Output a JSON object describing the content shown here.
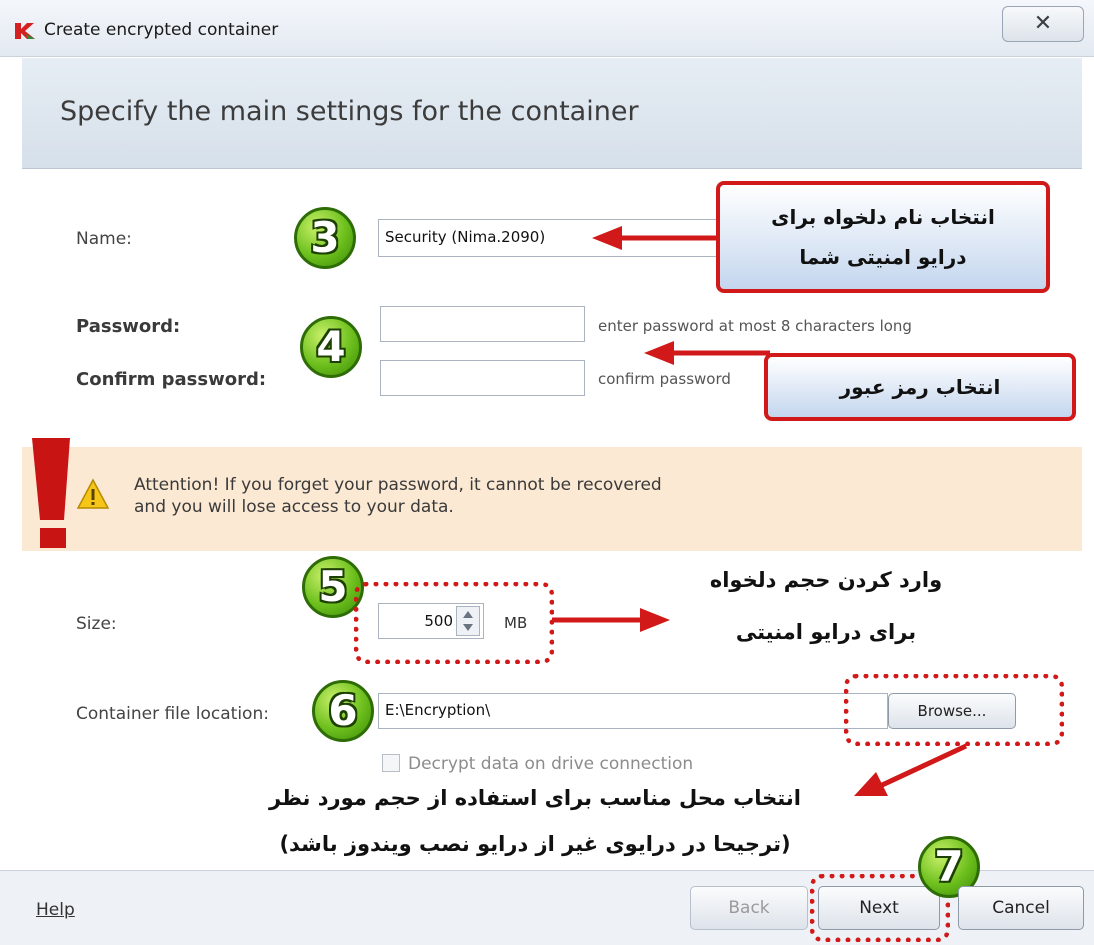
{
  "window": {
    "title": "Create encrypted container",
    "close_label": "✕"
  },
  "header": {
    "title": "Specify the main settings for the container"
  },
  "form": {
    "name_label": "Name:",
    "name_value": "Security (Nima.2090)",
    "password_label": "Password:",
    "password_hint": "enter password at most 8 characters long",
    "confirm_label": "Confirm password:",
    "confirm_hint": "confirm password",
    "size_label": "Size:",
    "size_value": "500",
    "size_unit": "MB",
    "location_label": "Container file location:",
    "location_value": "E:\\Encryption\\",
    "browse_label": "Browse...",
    "decrypt_label": "Decrypt data on drive connection"
  },
  "attention": {
    "line1": "Attention! If you forget your password, it cannot be recovered",
    "line2": "and you will lose access to your data."
  },
  "annotations": {
    "step3": "3",
    "step4": "4",
    "step5": "5",
    "step6": "6",
    "step7": "7",
    "callout_name_line1": "انتخاب نام دلخواه برای",
    "callout_name_line2": "درایو امنیتی شما",
    "callout_password": "انتخاب رمز عبور",
    "size_line1": "وارد کردن حجم دلخواه",
    "size_line2": "برای درایو امنیتی",
    "location_line1": "انتخاب محل مناسب برای استفاده از حجم مورد نظر",
    "location_line2": "(ترجیحا در درایوی غیر از درایو نصب ویندوز باشد)"
  },
  "footer": {
    "help_label": "Help",
    "back_label": "Back",
    "next_label": "Next",
    "cancel_label": "Cancel"
  },
  "colors": {
    "accent_red": "#d11919",
    "badge_green": "#6cbf1c",
    "attention_bg": "#fbe9d3"
  },
  "icons": [
    "kaspersky-logo-icon",
    "close-icon",
    "warning-icon",
    "exclamation-icon",
    "spinner-up-icon",
    "spinner-down-icon",
    "checkbox-icon",
    "arrow-icon"
  ]
}
